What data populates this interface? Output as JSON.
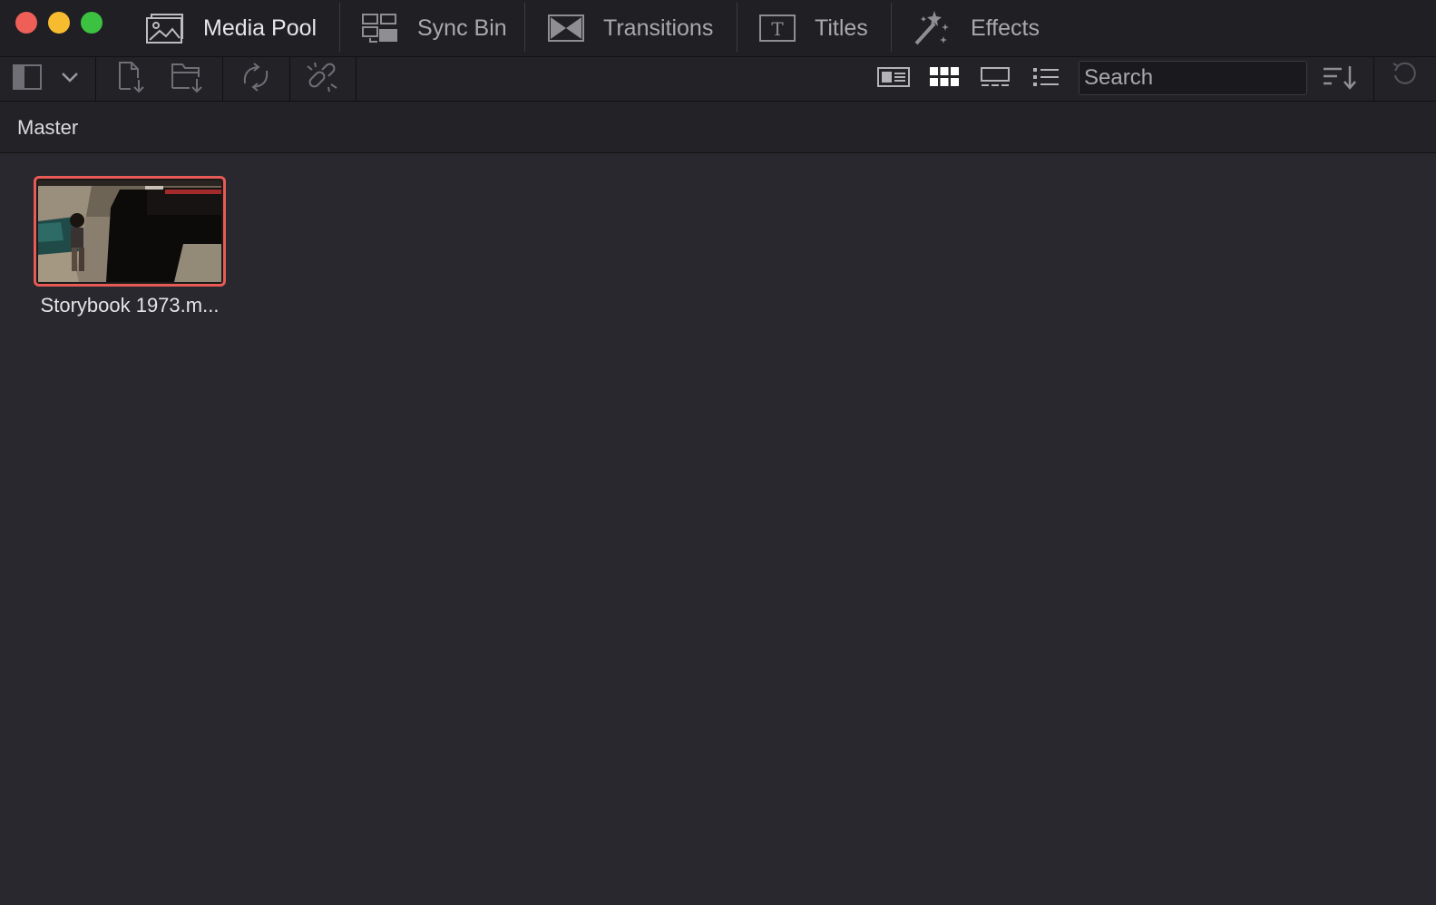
{
  "window": {
    "controls": [
      "close",
      "minimize",
      "zoom"
    ]
  },
  "tabs": [
    {
      "label": "Media Pool",
      "icon": "media-pool-icon",
      "active": true
    },
    {
      "label": "Sync Bin",
      "icon": "sync-bin-icon",
      "active": false
    },
    {
      "label": "Transitions",
      "icon": "transitions-icon",
      "active": false
    },
    {
      "label": "Titles",
      "icon": "titles-icon",
      "active": false
    },
    {
      "label": "Effects",
      "icon": "effects-icon",
      "active": false
    }
  ],
  "toolbar": {
    "left_tools": [
      "sidebar-toggle-icon",
      "chevron-down-icon",
      "import-media-icon",
      "import-folder-icon",
      "relink-icon",
      "unlink-icon"
    ],
    "view_modes": [
      "metadata-view-icon",
      "thumbnail-view-icon",
      "filmstrip-view-icon",
      "list-view-icon"
    ],
    "active_view": "thumbnail-view-icon",
    "search": {
      "placeholder": "Search",
      "value": ""
    },
    "right_tools": [
      "sort-icon",
      "refresh-icon"
    ]
  },
  "breadcrumb": {
    "current": "Master"
  },
  "clips": [
    {
      "name": "Storybook 1973.m...",
      "selected": true
    }
  ],
  "colors": {
    "selection": "#e85a56",
    "background": "#28282e",
    "panel": "#1f1f24"
  }
}
